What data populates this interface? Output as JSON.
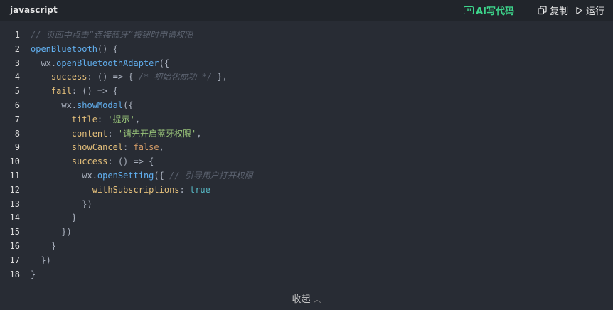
{
  "header": {
    "language": "javascript",
    "ai_label": "AI写代码",
    "ai_icon_text": "AI",
    "copy_label": "复制",
    "run_label": "运行"
  },
  "code": {
    "lines": [
      {
        "n": "1",
        "tokens": [
          [
            "c-comment",
            "// 页面中点击“连接蓝牙”按钮时申请权限"
          ]
        ]
      },
      {
        "n": "2",
        "tokens": [
          [
            "c-fn",
            "openBluetooth"
          ],
          [
            "c-plain",
            "() {"
          ]
        ]
      },
      {
        "n": "3",
        "tokens": [
          [
            "c-plain",
            "  wx."
          ],
          [
            "c-fn",
            "openBluetoothAdapter"
          ],
          [
            "c-plain",
            "({"
          ]
        ]
      },
      {
        "n": "4",
        "tokens": [
          [
            "c-plain",
            "    "
          ],
          [
            "c-prop",
            "success"
          ],
          [
            "c-plain",
            ": () => { "
          ],
          [
            "c-comment",
            "/* 初始化成功 */"
          ],
          [
            "c-plain",
            " },"
          ]
        ]
      },
      {
        "n": "5",
        "tokens": [
          [
            "c-plain",
            "    "
          ],
          [
            "c-prop",
            "fail"
          ],
          [
            "c-plain",
            ": () => {"
          ]
        ]
      },
      {
        "n": "6",
        "tokens": [
          [
            "c-plain",
            "      wx."
          ],
          [
            "c-fn",
            "showModal"
          ],
          [
            "c-plain",
            "({"
          ]
        ]
      },
      {
        "n": "7",
        "tokens": [
          [
            "c-plain",
            "        "
          ],
          [
            "c-prop",
            "title"
          ],
          [
            "c-plain",
            ": "
          ],
          [
            "c-str",
            "'提示'"
          ],
          [
            "c-plain",
            ","
          ]
        ]
      },
      {
        "n": "8",
        "tokens": [
          [
            "c-plain",
            "        "
          ],
          [
            "c-prop",
            "content"
          ],
          [
            "c-plain",
            ": "
          ],
          [
            "c-str",
            "'请先开启蓝牙权限'"
          ],
          [
            "c-plain",
            ","
          ]
        ]
      },
      {
        "n": "9",
        "tokens": [
          [
            "c-plain",
            "        "
          ],
          [
            "c-prop",
            "showCancel"
          ],
          [
            "c-plain",
            ": "
          ],
          [
            "c-bool",
            "false"
          ],
          [
            "c-plain",
            ","
          ]
        ]
      },
      {
        "n": "10",
        "tokens": [
          [
            "c-plain",
            "        "
          ],
          [
            "c-prop",
            "success"
          ],
          [
            "c-plain",
            ": () => {"
          ]
        ]
      },
      {
        "n": "11",
        "tokens": [
          [
            "c-plain",
            "          wx."
          ],
          [
            "c-fn",
            "openSetting"
          ],
          [
            "c-plain",
            "({ "
          ],
          [
            "c-comment",
            "// 引导用户打开权限"
          ]
        ]
      },
      {
        "n": "12",
        "tokens": [
          [
            "c-plain",
            "            "
          ],
          [
            "c-prop",
            "withSubscriptions"
          ],
          [
            "c-plain",
            ": "
          ],
          [
            "c-kw",
            "true"
          ]
        ]
      },
      {
        "n": "13",
        "tokens": [
          [
            "c-plain",
            "          })"
          ]
        ]
      },
      {
        "n": "14",
        "tokens": [
          [
            "c-plain",
            "        }"
          ]
        ]
      },
      {
        "n": "15",
        "tokens": [
          [
            "c-plain",
            "      })"
          ]
        ]
      },
      {
        "n": "16",
        "tokens": [
          [
            "c-plain",
            "    }"
          ]
        ]
      },
      {
        "n": "17",
        "tokens": [
          [
            "c-plain",
            "  })"
          ]
        ]
      },
      {
        "n": "18",
        "tokens": [
          [
            "c-plain",
            "}"
          ]
        ]
      }
    ]
  },
  "footer": {
    "collapse_label": "收起",
    "collapse_icon": "chevron-up-icon"
  },
  "colors": {
    "background": "#282c34",
    "header_bg": "#21252b",
    "ai_accent": "#3dd68c",
    "comment": "#5c6370",
    "function": "#61afef",
    "property": "#e5c07b",
    "string": "#98c379",
    "boolean": "#d19a66"
  }
}
